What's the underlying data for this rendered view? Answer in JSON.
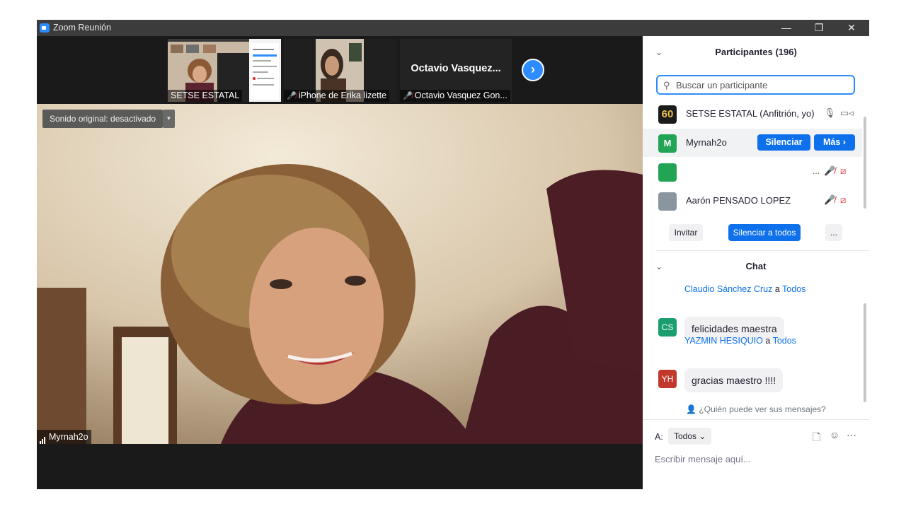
{
  "window": {
    "title": "Zoom Reunión",
    "minimize": "—",
    "restore": "❐",
    "close": "✕"
  },
  "strip": {
    "thumbs": [
      {
        "label": "SETSE ESTATAL",
        "muted": false
      },
      {
        "label": "iPhone de Erika lizette",
        "muted": true
      },
      {
        "label": "Octavio Vasquez Gon...",
        "muted": true,
        "center_name": "Octavio  Vasquez..."
      }
    ],
    "next_icon": "chevron-right-icon"
  },
  "main_video": {
    "sound_label": "Sonido original: desactivado",
    "name": "Myrnah2o"
  },
  "participants": {
    "title": "Participantes (196)",
    "search_placeholder": "Buscar un participante",
    "rows": [
      {
        "name": "SETSE ESTATAL (Anfitrión, yo)",
        "avatar": "60"
      },
      {
        "name": "Myrnah2o",
        "avatar": "M",
        "mute_label": "Silenciar",
        "more_label": "Más ›"
      },
      {
        "name": "",
        "avatar": "",
        "ellipsis": "..."
      },
      {
        "name": "Aarón PENSADO LOPEZ",
        "avatar": ""
      }
    ],
    "invite_label": "Invitar",
    "mute_all_label": "Silenciar a todos",
    "more_label": "..."
  },
  "chat": {
    "title": "Chat",
    "messages": [
      {
        "sender": "Claudio Sánchez Cruz",
        "connector": " a ",
        "recipient": "Todos",
        "initials": "CS",
        "text": "felicidades maestra",
        "color": "#1a9e6e"
      },
      {
        "sender": "YAZMIN HESIQUIO",
        "connector": " a ",
        "recipient": "Todos",
        "initials": "YH",
        "text": "gracias maestro !!!!",
        "color": "#c0392b"
      }
    ],
    "who_can_see": "¿Quién puede ver sus mensajes?",
    "to_label": "A:",
    "to_value": "Todos",
    "compose_placeholder": "Escribir mensaje aquí..."
  },
  "colors": {
    "accent": "#0e71eb",
    "muted_red": "#e02828",
    "titlebar": "#3c3c3c"
  }
}
